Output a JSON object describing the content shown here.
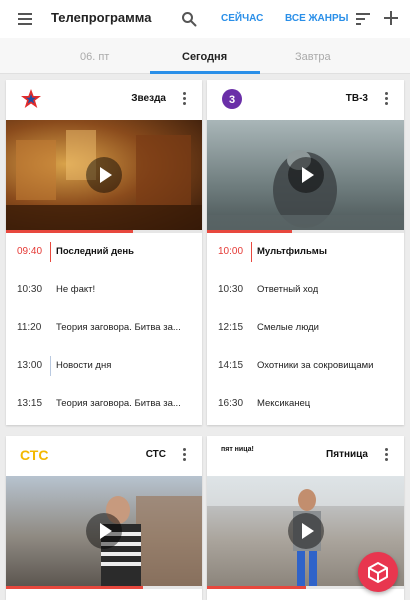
{
  "appbar": {
    "title": "Телепрограмма",
    "now_label": "СЕЙЧАС",
    "genres_label": "ВСЕ ЖАНРЫ",
    "accent_color": "#2a8fe8"
  },
  "tabs": [
    {
      "label": "06. пт",
      "active": false
    },
    {
      "label": "Сегодня",
      "active": true
    },
    {
      "label": "Завтра",
      "active": false
    }
  ],
  "channels": [
    {
      "name": "Звезда",
      "logo": "zvezda-star-logo",
      "progress": 0.65,
      "programs": [
        {
          "time": "09:40",
          "title": "Последний день",
          "live": true
        },
        {
          "time": "10:30",
          "title": "Не факт!",
          "live": false
        },
        {
          "time": "11:20",
          "title": "Теория заговора. Битва за...",
          "live": false
        },
        {
          "time": "13:00",
          "title": "Новости дня",
          "live": false
        },
        {
          "time": "13:15",
          "title": "Теория заговора. Битва за...",
          "live": false
        }
      ]
    },
    {
      "name": "ТВ-3",
      "logo": "tv3-logo",
      "progress": 0.43,
      "programs": [
        {
          "time": "10:00",
          "title": "Мультфильмы",
          "live": true
        },
        {
          "time": "10:30",
          "title": "Ответный ход",
          "live": false
        },
        {
          "time": "12:15",
          "title": "Смелые люди",
          "live": false
        },
        {
          "time": "14:15",
          "title": "Охотники за сокровищами",
          "live": false
        },
        {
          "time": "16:30",
          "title": "Мексиканец",
          "live": false
        }
      ]
    },
    {
      "name": "СТС",
      "logo": "ctc-logo",
      "logo_text": "СТС",
      "progress": 0.7
    },
    {
      "name": "Пятница",
      "logo": "pyatnica-logo",
      "logo_text": "пят ница!",
      "progress": 0.5
    }
  ],
  "icons": {
    "menu": "menu-icon",
    "search": "search-icon",
    "sort": "sort-icon",
    "add": "add-icon",
    "fab": "box-3d-icon"
  },
  "colors": {
    "live": "#e53935",
    "fab": "#e8364f"
  }
}
